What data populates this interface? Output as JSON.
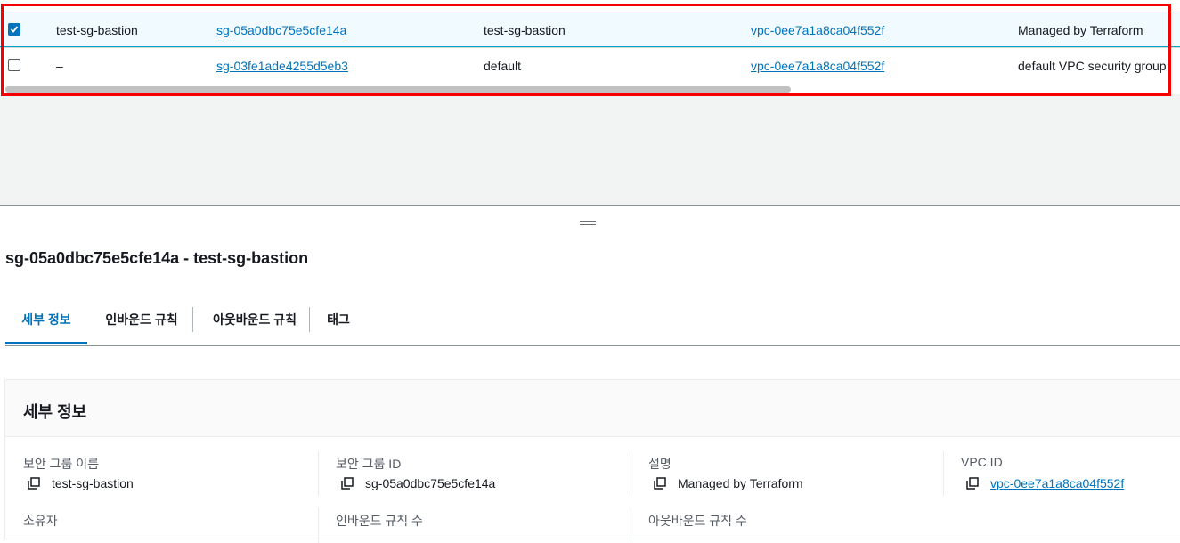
{
  "table": {
    "rows": [
      {
        "name": "test-sg-bastion",
        "id": "sg-05a0dbc75e5cfe14a",
        "group_name": "test-sg-bastion",
        "vpc": "vpc-0ee7a1a8ca04f552f",
        "description": "Managed by Terraform",
        "checked": true
      },
      {
        "name": "–",
        "id": "sg-03fe1ade4255d5eb3",
        "group_name": "default",
        "vpc": "vpc-0ee7a1a8ca04f552f",
        "description": "default VPC security group",
        "checked": false
      }
    ]
  },
  "detail": {
    "title": "sg-05a0dbc75e5cfe14a - test-sg-bastion",
    "tabs": [
      {
        "label": "세부 정보",
        "active": true
      },
      {
        "label": "인바운드 규칙",
        "active": false
      },
      {
        "label": "아웃바운드 규칙",
        "active": false
      },
      {
        "label": "태그",
        "active": false
      }
    ],
    "panel": {
      "title": "세부 정보",
      "fields": [
        {
          "label": "보안 그룹 이름",
          "value": "test-sg-bastion"
        },
        {
          "label": "보안 그룹 ID",
          "value": "sg-05a0dbc75e5cfe14a"
        },
        {
          "label": "설명",
          "value": "Managed by Terraform"
        },
        {
          "label": "VPC ID",
          "value": "vpc-0ee7a1a8ca04f552f"
        }
      ],
      "fields_row2": [
        {
          "label": "소유자"
        },
        {
          "label": "인바운드 규칙 수"
        },
        {
          "label": "아웃바운드 규칙 수"
        }
      ]
    }
  },
  "colors": {
    "accent": "#0073bb",
    "highlight": "#f40000"
  },
  "icons": {
    "copy": "copy-icon",
    "check": "checkmark-icon",
    "splitter": "drag-handle-icon"
  }
}
